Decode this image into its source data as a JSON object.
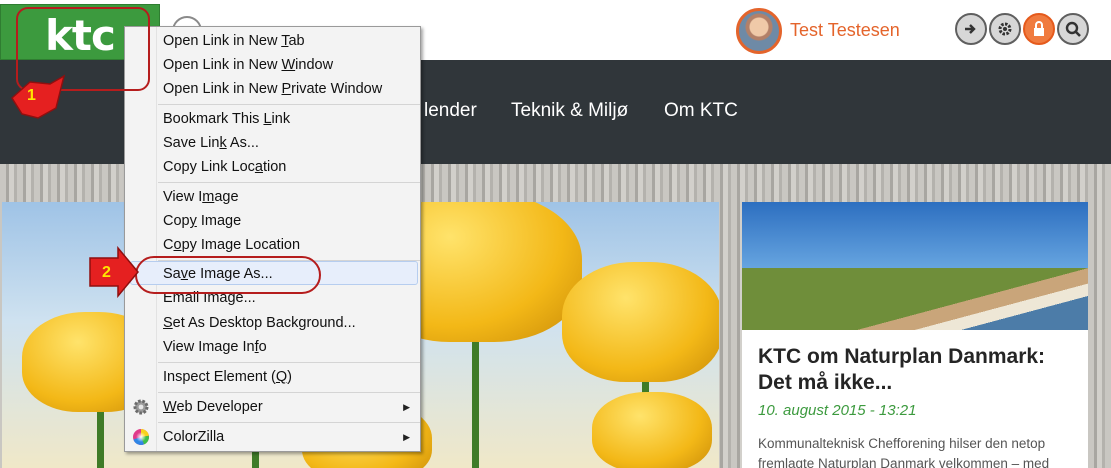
{
  "header": {
    "logo_text": "ktc",
    "user_name": "Test Testesen"
  },
  "nav": {
    "items": [
      "lender",
      "Teknik & Miljø",
      "Om KTC"
    ]
  },
  "context_menu": {
    "items": [
      {
        "pre": "Open Link in New ",
        "key": "T",
        "post": "ab"
      },
      {
        "pre": "Open Link in New ",
        "key": "W",
        "post": "indow"
      },
      {
        "pre": "Open Link in New ",
        "key": "P",
        "post": "rivate Window"
      },
      {
        "pre": "Bookmark This ",
        "key": "L",
        "post": "ink"
      },
      {
        "pre": "Save Lin",
        "key": "k",
        "post": " As..."
      },
      {
        "pre": "Copy Link Loc",
        "key": "a",
        "post": "tion"
      },
      {
        "pre": "View I",
        "key": "m",
        "post": "age"
      },
      {
        "pre": "Cop",
        "key": "y",
        "post": " Image"
      },
      {
        "pre": "C",
        "key": "o",
        "post": "py Image Location"
      },
      {
        "pre": "Sa",
        "key": "v",
        "post": "e Image As..."
      },
      {
        "pre": "Email Ima",
        "key": "g",
        "post": "e..."
      },
      {
        "pre": "",
        "key": "S",
        "post": "et As Desktop Background..."
      },
      {
        "pre": "View Image In",
        "key": "f",
        "post": "o"
      },
      {
        "pre": "Inspect Element (",
        "key": "Q",
        "post": ")"
      },
      {
        "pre": "",
        "key": "W",
        "post": "eb Developer"
      },
      {
        "pre": "ColorZilla",
        "key": "",
        "post": ""
      }
    ]
  },
  "annotations": {
    "step1": "1",
    "step2": "2"
  },
  "article": {
    "title": "KTC om Naturplan Danmark: Det må ikke...",
    "date": "10. august 2015 - 13:21",
    "excerpt": "Kommunalteknisk Chefforening hilser den netop fremlagte Naturplan Danmark velkommen – med"
  },
  "colors": {
    "brand_green": "#3c9a3e",
    "accent_orange": "#e4642b",
    "nav_bg": "#30363a",
    "annotation_red": "#b51d1d",
    "annotation_yellow": "#ffe500"
  }
}
